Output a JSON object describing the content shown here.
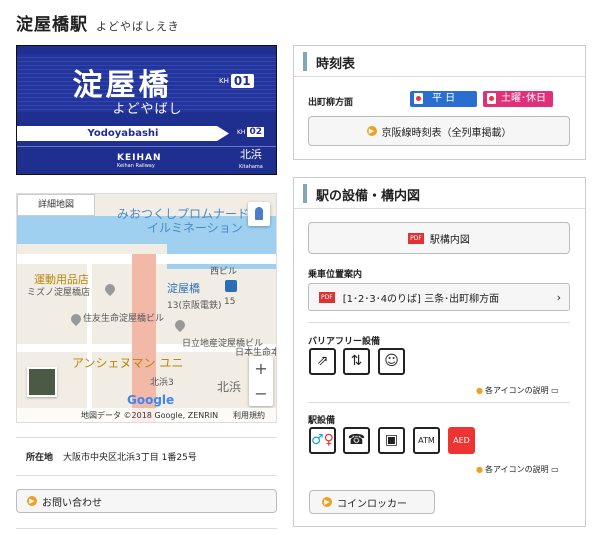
{
  "header": {
    "title": "淀屋橋駅",
    "kana": "よどやばしえき"
  },
  "sign": {
    "name": "淀屋橋",
    "code_prefix": "KH",
    "code_number": "01",
    "kana": "よどやばし",
    "romaji": "Yodoyabashi",
    "next_code_prefix": "KH",
    "next_code_number": "02",
    "logo": "KEIHAN",
    "logo_sub": "Keihan Railway",
    "next_name": "北浜",
    "next_name_romaji": "Kitahama"
  },
  "map": {
    "detail_button": "詳細地図",
    "labels": {
      "promenade1": "みおつくしプロムナード",
      "promenade2": "イルミネーション",
      "building1": "運動用品店",
      "building2": "ミズノ淀屋橋店",
      "station": "淀屋橋",
      "keihan": "(京阪電鉄)",
      "sumitomo": "住友生命淀屋橋ビル",
      "hitachi": "日立地産淀屋橋ビル",
      "nihonsei": "日本生命本",
      "ansheng": "アンシェヌマン ユニ",
      "kitahama3": "北浜3",
      "kitahama": "北浜",
      "nishi": "西ビル",
      "num13": "13(京阪電鉄)",
      "num15": "15"
    },
    "google": "Google",
    "credit_data": "地図データ ©2018 Google, ZENRIN",
    "credit_terms": "利用規約",
    "zoom_in": "+",
    "zoom_out": "−"
  },
  "address": {
    "label": "所在地",
    "value": "大阪市中央区北浜3丁目 1番25号"
  },
  "contact_button": "お問い合わせ",
  "timetable": {
    "title": "時刻表",
    "direction": "出町柳方面",
    "weekday": "平 日",
    "holiday": "土曜･休日",
    "line_button": "京阪線時刻表（全列車掲載）",
    "weekday_color": "#2a6fcf",
    "holiday_color": "#e0307a"
  },
  "facilities": {
    "title": "駅の設備・構内図",
    "map_button": "駅構内図",
    "boarding_title": "乗車位置案内",
    "boarding_item": "[1･2･3･4のりば] 三条･出町柳方面",
    "barrier_title": "バリアフリー設備",
    "help1": "各アイコンの説明",
    "station_title": "駅設備",
    "help2": "各アイコンの説明",
    "atm": "ATM",
    "aed": "AED",
    "locker_button": "コインロッカー",
    "pdf": "PDF"
  }
}
